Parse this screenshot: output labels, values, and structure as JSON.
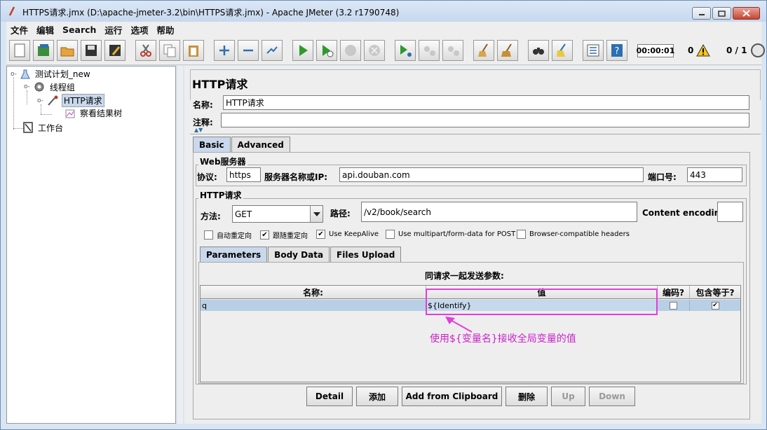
{
  "window": {
    "title": "HTTPS请求.jmx (D:\\apache-jmeter-3.2\\bin\\HTTPS请求.jmx) - Apache JMeter (3.2 r1790748)"
  },
  "menu": [
    "文件",
    "编辑",
    "Search",
    "运行",
    "选项",
    "帮助"
  ],
  "toolbar": {
    "timer": "00:00:01",
    "error_count": "0",
    "thread_count": "0 / 1"
  },
  "tree": {
    "test_plan": "测试计划_new",
    "thread_group": "线程组",
    "http_request": "HTTP请求",
    "result_tree": "察看结果树",
    "workbench": "工作台"
  },
  "panel": {
    "title": "HTTP请求",
    "name_label": "名称:",
    "name_value": "HTTP请求",
    "comment_label": "注释:",
    "comment_value": ""
  },
  "tabs": {
    "basic": "Basic",
    "advanced": "Advanced"
  },
  "web_server": {
    "group_title": "Web服务器",
    "protocol_label": "协议:",
    "protocol_value": "https",
    "server_label": "服务器名称或IP:",
    "server_value": "api.douban.com",
    "port_label": "端口号:",
    "port_value": "443"
  },
  "http_request": {
    "group_title": "HTTP请求",
    "method_label": "方法:",
    "method_value": "GET",
    "path_label": "路径:",
    "path_value": "/v2/book/search",
    "encoding_label": "Content encoding:",
    "encoding_value": "",
    "checkboxes": [
      {
        "label": "自动重定向",
        "checked": false
      },
      {
        "label": "跟随重定向",
        "checked": true
      },
      {
        "label": "Use KeepAlive",
        "checked": true
      },
      {
        "label": "Use multipart/form-data for POST",
        "checked": false
      },
      {
        "label": "Browser-compatible headers",
        "checked": false
      }
    ]
  },
  "param_tabs": {
    "parameters": "Parameters",
    "body": "Body Data",
    "files": "Files Upload"
  },
  "params": {
    "heading": "同请求一起发送参数:",
    "columns": [
      "名称:",
      "值",
      "编码?",
      "包含等于?"
    ],
    "rows": [
      {
        "name": "q",
        "value": "${Identify}",
        "encode": false,
        "include_equals": true
      }
    ]
  },
  "annotation": "使用${变量名}接收全局变量的值",
  "buttons": {
    "detail": "Detail",
    "add": "添加",
    "clipboard": "Add from Clipboard",
    "delete": "删除",
    "up": "Up",
    "down": "Down"
  },
  "colors": {
    "accent": "#c9d8ec",
    "annotation": "#e040d8",
    "selected_row": "#b8cfe5"
  }
}
